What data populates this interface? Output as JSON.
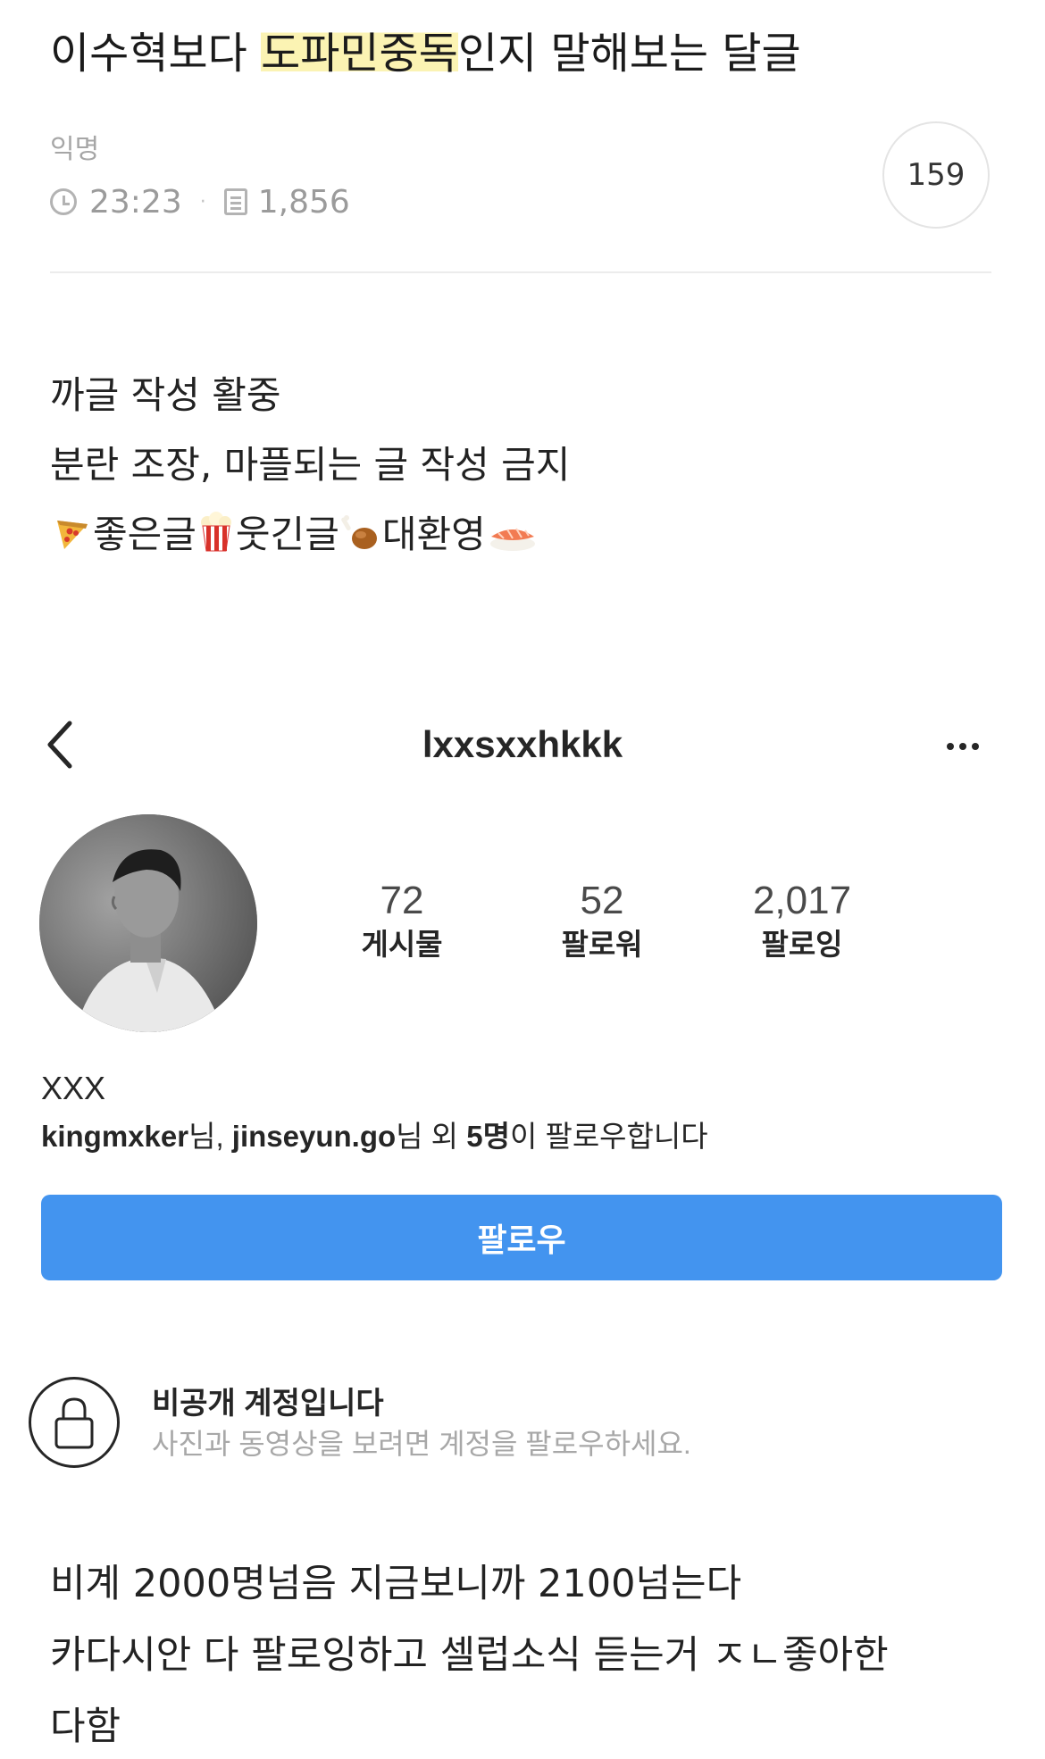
{
  "post": {
    "title_pre": "이수혁보다 ",
    "title_highlight": "도파민중독",
    "title_post": "인지 말해보는 달글",
    "author": "익명",
    "time": "23:23",
    "views": "1,856",
    "comment_count": "159",
    "highlight_color": "#fbf3b3"
  },
  "rules": {
    "line1": "까글 작성 활중",
    "line2": "분란 조장, 마플되는 글 작성 금지",
    "line3_a": "좋은글",
    "line3_b": "웃긴글",
    "line3_c": "대환영",
    "icons": [
      "pizza-icon",
      "popcorn-icon",
      "chicken-leg-icon",
      "sushi-icon"
    ]
  },
  "instagram": {
    "username": "lxxsxxhkkk",
    "stats": [
      {
        "value": "72",
        "label": "게시물"
      },
      {
        "value": "52",
        "label": "팔로워"
      },
      {
        "value": "2,017",
        "label": "팔로잉"
      }
    ],
    "name": "XXX",
    "followed_by": {
      "user1": "kingmxker",
      "suffix1": "님, ",
      "user2": "jinseyun.go",
      "suffix2": "님 외 ",
      "count": "5명",
      "suffix3": "이 팔로우합니다"
    },
    "follow_label": "팔로우",
    "follow_color": "#4394ef",
    "private_title": "비공개 계정입니다",
    "private_subtitle": "사진과 동영상을 보려면 계정을 팔로우하세요."
  },
  "body": {
    "line1": "비계 2000명넘음 지금보니까 2100넘는다",
    "line2": "카다시안 다 팔로잉하고 셀럽소식 듣는거 ㅈㄴ좋아한",
    "line3": "다함"
  }
}
